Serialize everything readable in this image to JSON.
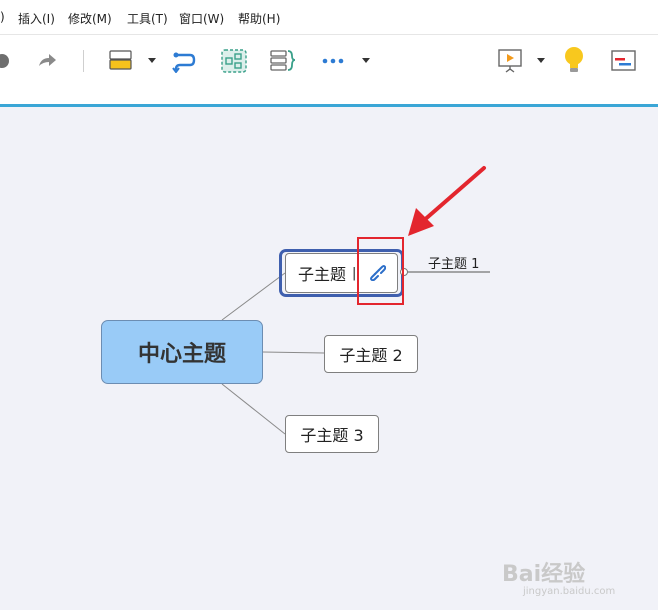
{
  "menu": {
    "items": [
      ")",
      "插入(I)",
      "修改(M)",
      "工具(T)",
      "窗口(W)",
      "帮助(H)"
    ]
  },
  "toolbar": {
    "icons": [
      "undo-icon",
      "redo-icon",
      "topic-style-icon",
      "relationship-icon",
      "boundary-icon",
      "summary-icon",
      "more-icon",
      "presentation-icon",
      "idea-bulb-icon",
      "gantt-icon"
    ]
  },
  "mindmap": {
    "central_topic": "中心主题",
    "subtopics": [
      "子主题",
      "子主题 2",
      "子主题 3"
    ],
    "floating_label": "子主题 1"
  },
  "watermark": {
    "brand": "Bai经验",
    "url": "jingyan.baidu.com"
  },
  "colors": {
    "accent_bar": "#3aa6d6",
    "central_fill": "#99cbf7",
    "selection_border": "#3f5fae",
    "highlight_box": "#e3262e",
    "arrow": "#e3262e"
  }
}
